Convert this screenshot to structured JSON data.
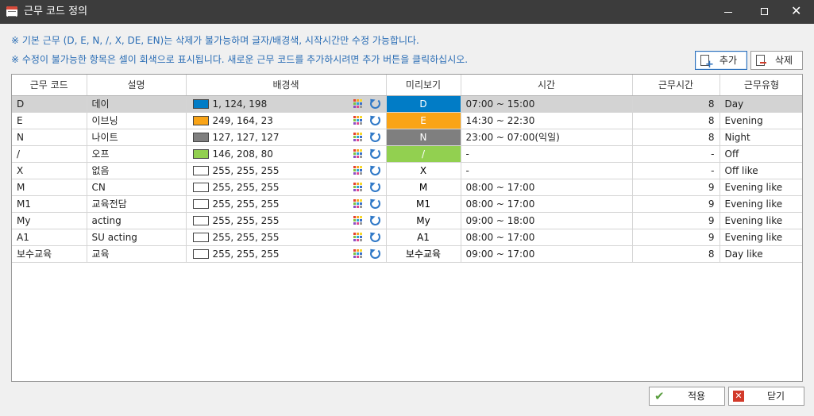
{
  "window": {
    "title": "근무 코드 정의",
    "minimize_icon": "minimize-icon",
    "maximize_icon": "maximize-icon",
    "close_icon": "close-icon"
  },
  "notices": [
    "※ 기본 근무 (D, E, N, /, X, DE, EN)는 삭제가 불가능하며 글자/배경색, 시작시간만 수정 가능합니다.",
    "※ 수정이 불가능한 항목은 셀이 회색으로 표시됩니다. 새로운 근무 코드를 추가하시려면 추가 버튼을 클릭하십시오."
  ],
  "toolbar": {
    "add_label": "추가",
    "delete_label": "삭제"
  },
  "table": {
    "columns": [
      "근무 코드",
      "설명",
      "배경색",
      "미리보기",
      "시간",
      "근무시간",
      "근무유형"
    ],
    "rows": [
      {
        "code": "D",
        "desc": "데이",
        "color_text": "1, 124, 198",
        "color_hex": "#017cc6",
        "preview": "D",
        "preview_fg": "#ffffff",
        "time": "07:00 ~ 15:00",
        "hours": "8",
        "type": "Day",
        "selected": true
      },
      {
        "code": "E",
        "desc": "이브닝",
        "color_text": "249, 164, 23",
        "color_hex": "#f9a417",
        "preview": "E",
        "preview_fg": "#ffffff",
        "time": "14:30 ~ 22:30",
        "hours": "8",
        "type": "Evening",
        "selected": false
      },
      {
        "code": "N",
        "desc": "나이트",
        "color_text": "127, 127, 127",
        "color_hex": "#7f7f7f",
        "preview": "N",
        "preview_fg": "#ffffff",
        "time": "23:00 ~ 07:00(익일)",
        "hours": "8",
        "type": "Night",
        "selected": false
      },
      {
        "code": "/",
        "desc": "오프",
        "color_text": "146, 208, 80",
        "color_hex": "#92d050",
        "preview": "/",
        "preview_fg": "#ffffff",
        "time": "-",
        "hours": "-",
        "type": "Off",
        "selected": false
      },
      {
        "code": "X",
        "desc": "없음",
        "color_text": "255, 255, 255",
        "color_hex": "#ffffff",
        "preview": "X",
        "preview_fg": "#000000",
        "time": "-",
        "hours": "-",
        "type": "Off like",
        "selected": false
      },
      {
        "code": "M",
        "desc": "CN",
        "color_text": "255, 255, 255",
        "color_hex": "#ffffff",
        "preview": "M",
        "preview_fg": "#000000",
        "time": "08:00 ~ 17:00",
        "hours": "9",
        "type": "Evening like",
        "selected": false
      },
      {
        "code": "M1",
        "desc": "교육전담",
        "color_text": "255, 255, 255",
        "color_hex": "#ffffff",
        "preview": "M1",
        "preview_fg": "#000000",
        "time": "08:00 ~ 17:00",
        "hours": "9",
        "type": "Evening like",
        "selected": false
      },
      {
        "code": "My",
        "desc": "acting",
        "color_text": "255, 255, 255",
        "color_hex": "#ffffff",
        "preview": "My",
        "preview_fg": "#000000",
        "time": "09:00 ~ 18:00",
        "hours": "9",
        "type": "Evening like",
        "selected": false
      },
      {
        "code": "A1",
        "desc": "SU acting",
        "color_text": "255, 255, 255",
        "color_hex": "#ffffff",
        "preview": "A1",
        "preview_fg": "#000000",
        "time": "08:00 ~ 17:00",
        "hours": "9",
        "type": "Evening like",
        "selected": false
      },
      {
        "code": "보수교육",
        "desc": "교육",
        "color_text": "255, 255, 255",
        "color_hex": "#ffffff",
        "preview": "보수교육",
        "preview_fg": "#000000",
        "time": "09:00 ~ 17:00",
        "hours": "8",
        "type": "Day like",
        "selected": false
      }
    ]
  },
  "footer": {
    "apply_label": "적용",
    "close_label": "닫기"
  },
  "colors": {
    "notice_text": "#2a6db5",
    "selected_row": "#d3d3d3",
    "titlebar": "#3c3c3c"
  }
}
